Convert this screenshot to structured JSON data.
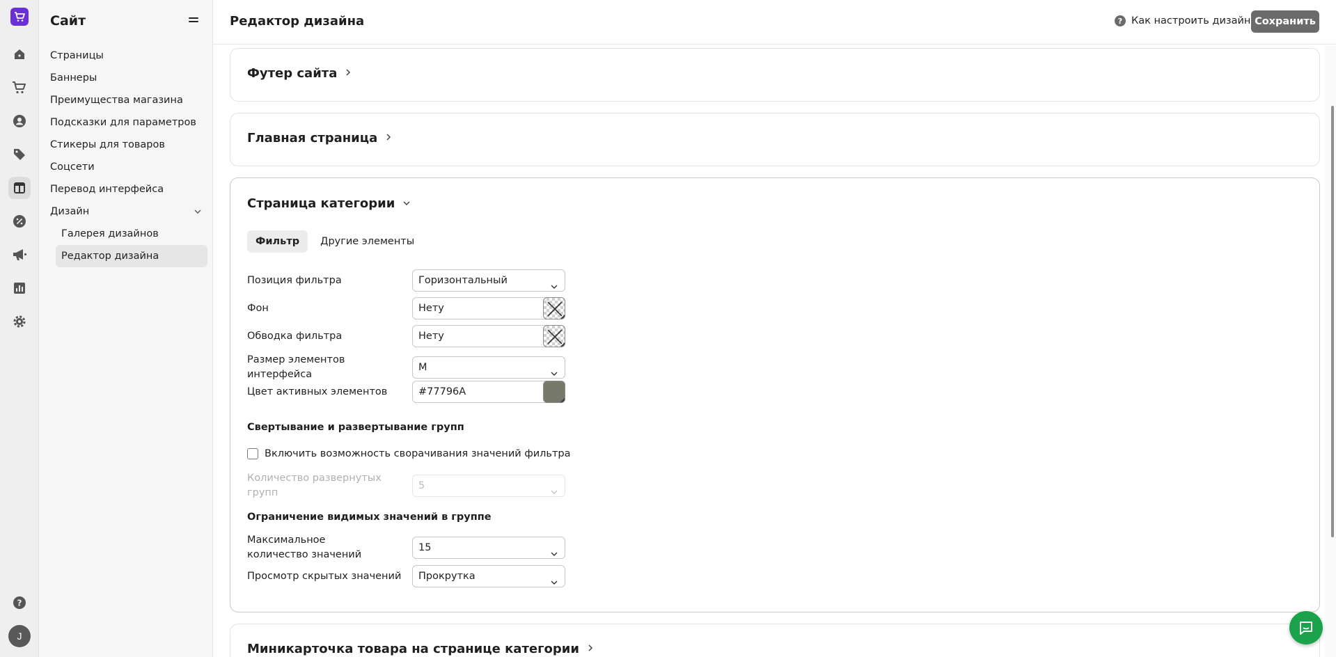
{
  "rail": {
    "icons": [
      "cart-logo-icon",
      "home-icon",
      "cart-icon",
      "user-icon",
      "tag-icon",
      "layout-icon",
      "discount-icon",
      "megaphone-icon",
      "chart-icon",
      "gear-icon",
      "help-icon"
    ],
    "avatar_letter": "J",
    "brand_color": "#6a2fd6"
  },
  "sidebar": {
    "title": "Сайт",
    "items": [
      {
        "label": "Страницы"
      },
      {
        "label": "Баннеры"
      },
      {
        "label": "Преимущества магазина"
      },
      {
        "label": "Подсказки для параметров"
      },
      {
        "label": "Стикеры для товаров"
      },
      {
        "label": "Соцсети"
      },
      {
        "label": "Перевод интерфейса"
      },
      {
        "label": "Дизайн"
      }
    ],
    "subitems": [
      {
        "label": "Галерея дизайнов"
      },
      {
        "label": "Редактор дизайна"
      }
    ]
  },
  "header": {
    "title": "Редактор дизайна",
    "help_link": "Как настроить дизайн",
    "save_label": "Сохранить"
  },
  "sections": {
    "footer": "Футер сайта",
    "home": "Главная страница",
    "category": "Страница категории",
    "minicard": "Миникарточка товара на странице категории"
  },
  "tabs": [
    "Фильтр",
    "Другие элементы"
  ],
  "form": {
    "filter_position": {
      "label": "Позиция фильтра",
      "value": "Горизонтальный"
    },
    "background": {
      "label": "Фон",
      "value": "Нету"
    },
    "filter_border": {
      "label": "Обводка фильтра",
      "value": "Нету"
    },
    "ui_size": {
      "label": "Размер элементов интерфейса",
      "value": "M"
    },
    "active_color": {
      "label": "Цвет активных элементов",
      "value": "#77796A",
      "swatch": "#77796A"
    },
    "collapse_heading": "Свертывание и развертывание групп",
    "collapse_checkbox": "Включить возможность сворачивания значений фильтра",
    "expanded_groups": {
      "label": "Количество развернутых групп",
      "value": "5"
    },
    "limit_heading": "Ограничение видимых значений в группе",
    "max_values": {
      "label": "Максимальное количество значений",
      "value": "15"
    },
    "hidden_view": {
      "label": "Просмотр скрытых значений",
      "value": "Прокрутка"
    }
  },
  "colors": {
    "save_button": "#6b6b6b",
    "chat_button": "#1aa34a"
  }
}
